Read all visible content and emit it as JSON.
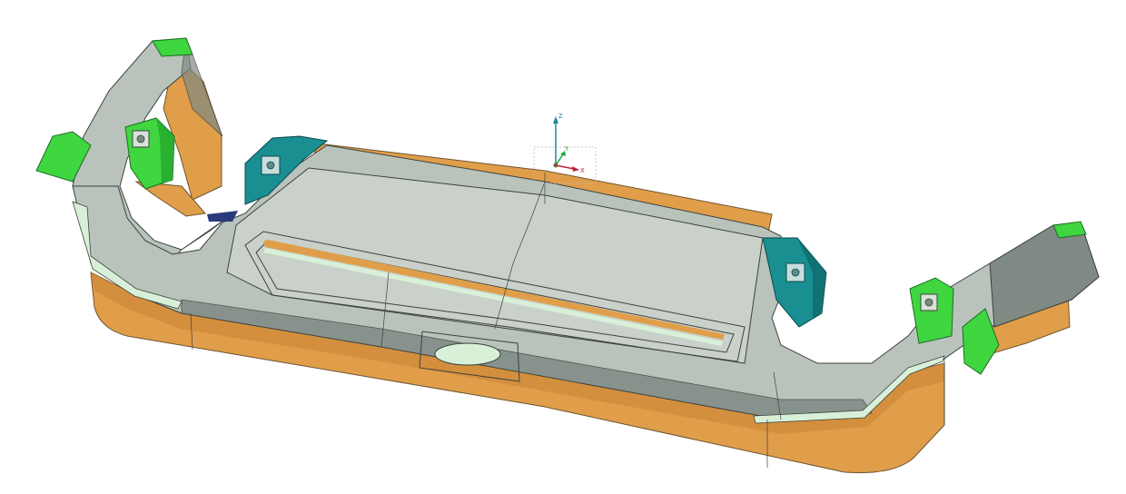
{
  "viewport": {
    "background": "#ffffff",
    "model": {
      "surface_color": "#b9c3bb",
      "surface_light": "#c9d1ca",
      "surface_dark": "#7f8a84",
      "edge_color": "#3d423f",
      "base_color": "#e09e4a",
      "base_dark": "#c98435",
      "highlight_color": "#d8f0d8",
      "clamp_green": "#3fd640",
      "clamp_green_dark": "#25a82e",
      "clamp_teal": "#1a8f92",
      "clamp_teal_dark": "#0f6a6e"
    }
  },
  "triad": {
    "labels": {
      "x": "X",
      "y": "Y",
      "z": "Z"
    },
    "colors": {
      "x": "#c0223a",
      "y": "#18a83a",
      "z": "#1a8a9e"
    }
  }
}
